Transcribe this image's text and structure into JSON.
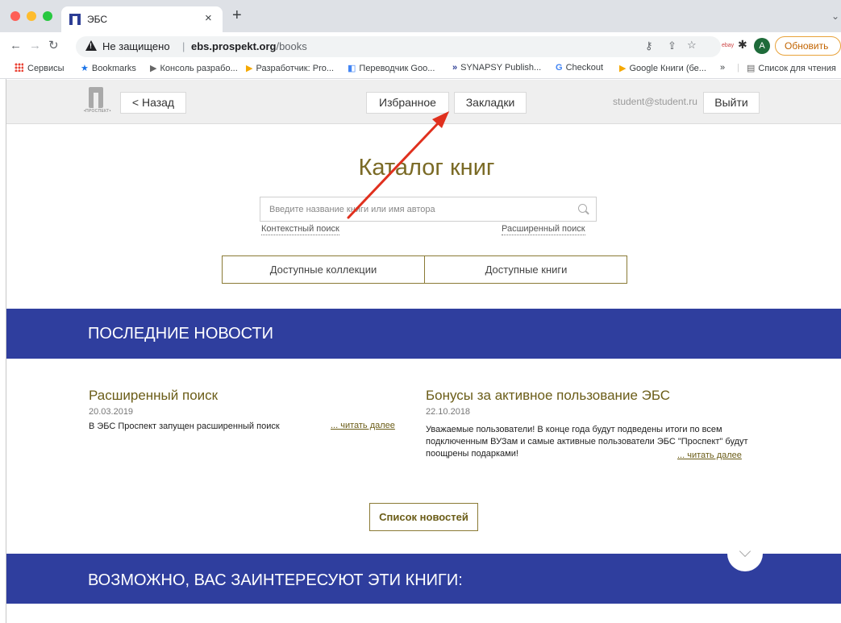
{
  "browser": {
    "tab_title": "ЭБС",
    "tab_close": "×",
    "new_tab": "+",
    "not_secure": "Не защищено",
    "separator": "|",
    "url_host": "ebs.prospekt.org",
    "url_path": "/books",
    "update_button": "Обновить",
    "update_menu": "⋮",
    "avatar_letter": "A",
    "bookmarks": [
      "Сервисы",
      "Bookmarks",
      "Консоль разрабо...",
      "Разработчик: Pro...",
      "Переводчик Goo...",
      "SYNAPSY Publish...",
      "Checkout",
      "Google Книги (бе...",
      "»",
      "Список для чтения"
    ]
  },
  "header": {
    "logo_text": "•ПРОСПЕКТ•",
    "back_label": "< Назад",
    "favorites_label": "Избранное",
    "bookmarks_label": "Закладки",
    "user_email": "student@student.ru",
    "logout_label": "Выйти"
  },
  "catalog": {
    "title": "Каталог книг",
    "search_placeholder": "Введите название книги или имя автора",
    "context_search": "Контекстный поиск",
    "advanced_search": "Расширенный поиск",
    "available_collections": "Доступные коллекции",
    "available_books": "Доступные книги"
  },
  "news": {
    "section_title": "ПОСЛЕДНИЕ НОВОСТИ",
    "items": [
      {
        "title": "Расширенный поиск",
        "date": "20.03.2019",
        "text": "В ЭБС Проспект запущен расширенный поиск",
        "read_more": "... читать далее"
      },
      {
        "title": "Бонусы за активное пользование ЭБС",
        "date": "22.10.2018",
        "text": "Уважаемые пользователи! В конце года будут подведены итоги по всем подключенным ВУЗам и самые активные пользователи ЭБС \"Проспект\" будут поощрены подарками!",
        "read_more": "... читать далее"
      }
    ],
    "list_button": "Список новостей"
  },
  "recommendations": {
    "section_title": "ВОЗМОЖНО, ВАС ЗАИНТЕРЕСУЮТ ЭТИ КНИГИ:"
  },
  "colors": {
    "accent_blue": "#2f3e9e",
    "gold_text": "#6b5d18",
    "annotation_arrow": "#e0301e"
  }
}
